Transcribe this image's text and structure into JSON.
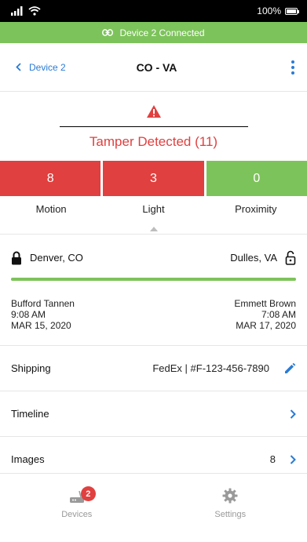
{
  "status_bar": {
    "battery": "100%",
    "battery_level": 1.0
  },
  "connection_banner": {
    "text": "Device 2 Connected"
  },
  "nav": {
    "back_label": "Device 2",
    "title": "CO - VA"
  },
  "alert": {
    "text": "Tamper Detected (11)"
  },
  "sensors": [
    {
      "count": "8",
      "label": "Motion",
      "color": "#e0403f"
    },
    {
      "count": "3",
      "label": "Light",
      "color": "#e0403f"
    },
    {
      "count": "0",
      "label": "Proximity",
      "color": "#7dc35b"
    }
  ],
  "route": {
    "origin": "Denver, CO",
    "destination": "Dulles, VA",
    "progress": 1.0,
    "origin_person": {
      "name": "Bufford Tannen",
      "time": "9:08 AM",
      "date": "MAR 15, 2020"
    },
    "dest_person": {
      "name": "Emmett Brown",
      "time": "7:08 AM",
      "date": "MAR 17, 2020"
    }
  },
  "details": {
    "shipping": {
      "label": "Shipping",
      "value": "FedEx | #F-123-456-7890"
    },
    "timeline": {
      "label": "Timeline"
    },
    "images": {
      "label": "Images",
      "value": "8"
    }
  },
  "tabbar": {
    "devices": {
      "label": "Devices",
      "badge": "2"
    },
    "settings": {
      "label": "Settings"
    }
  },
  "colors": {
    "accent": "#2a7bd4",
    "alert": "#e0403f",
    "success": "#7dc35b"
  }
}
